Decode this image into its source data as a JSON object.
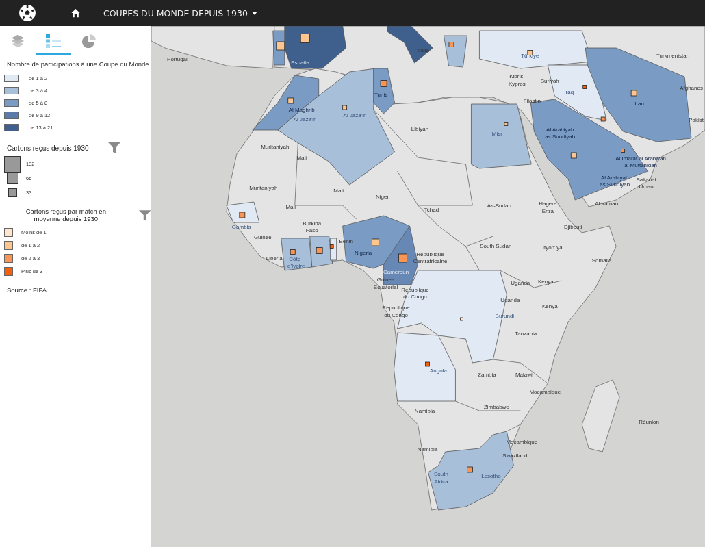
{
  "topbar": {
    "title": "COUPES DU MONDE DEPUIS 1930"
  },
  "tabs": [
    {
      "kind": "layers",
      "selected": false
    },
    {
      "kind": "legend",
      "selected": true
    },
    {
      "kind": "chart",
      "selected": false
    }
  ],
  "legend": {
    "participations": {
      "title": "Nombre de participations à une Coupe du Monde",
      "items": [
        {
          "label": "de 1 à 2",
          "color": "#e0e9f4"
        },
        {
          "label": "de 3 à 4",
          "color": "#a8bfda"
        },
        {
          "label": "de 5 à 8",
          "color": "#7a9cc4"
        },
        {
          "label": "de 9 à 12",
          "color": "#5b7bab"
        },
        {
          "label": "de 13 à 21",
          "color": "#3f5f8c"
        }
      ]
    },
    "cards": {
      "title": "Cartons reçus depuis 1930",
      "items": [
        {
          "label": "132"
        },
        {
          "label": "66"
        },
        {
          "label": "33"
        }
      ]
    },
    "cards_per_match": {
      "title": "Cartons reçus par match en moyenne depuis 1930",
      "items": [
        {
          "label": "Moins de 1",
          "color": "#fee6ce"
        },
        {
          "label": "de 1 à 2",
          "color": "#fdc691"
        },
        {
          "label": "de 2 à 3",
          "color": "#f99656"
        },
        {
          "label": "Plus de 3",
          "color": "#f4600c"
        }
      ]
    },
    "source": "Source : FIFA"
  },
  "map": {
    "regions": [
      {
        "color": "#3f5f8c"
      },
      {
        "color": "#7a9cc4"
      },
      {
        "color": "#3f5f8c"
      },
      {
        "color": "#a8bfda"
      },
      {
        "color": "#e0e9f4"
      },
      {
        "color": "#7a9cc4"
      },
      {
        "color": "#e0e9f4"
      },
      {
        "color": "#7a9cc4"
      },
      {
        "color": "#a8bfda"
      },
      {
        "color": "#7a9cc4"
      },
      {
        "color": "#a8bfda"
      },
      {
        "color": "#7a9cc4"
      },
      {
        "color": "#e0e9f4"
      },
      {
        "color": "#a8bfda"
      },
      {
        "color": "#a8bfda"
      },
      {
        "color": "#e0e9f4"
      },
      {
        "color": "#7a9cc4"
      },
      {
        "color": "#6787b5"
      },
      {
        "color": "#e0e9f4"
      },
      {
        "color": "#e0e9f4"
      },
      {
        "color": "#a8bfda"
      }
    ],
    "markers": [
      {
        "color": "#fdc691"
      },
      {
        "color": "#fdc691"
      },
      {
        "color": "#f99656"
      },
      {
        "color": "#fdc691"
      },
      {
        "color": "#f4600c"
      },
      {
        "color": "#fdc691"
      },
      {
        "color": "#f99656"
      },
      {
        "color": "#fdc691"
      },
      {
        "color": "#fdc691"
      },
      {
        "color": "#fdc691"
      },
      {
        "color": "#fdc691"
      },
      {
        "color": "#f99656"
      },
      {
        "color": "#f99656"
      },
      {
        "color": "#f99656"
      },
      {
        "color": "#f99656"
      },
      {
        "color": "#f99656"
      },
      {
        "color": "#f4600c"
      },
      {
        "color": "#fdc691"
      },
      {
        "color": "#f99656"
      },
      {
        "color": "#fee6ce"
      },
      {
        "color": "#f4600c"
      },
      {
        "color": "#f99656"
      }
    ],
    "labels": [
      "Portugal",
      "España",
      "Italia",
      "Türkiye",
      "Turkmenistan",
      "Kibris,",
      "Kypros",
      "Suriyah",
      "Iraq",
      "Iran",
      "Afghanes",
      "Pakist",
      "Filastin",
      "Al Maghrib",
      "Al Jaza'ir",
      "Al Jaza'ir",
      "Tunis",
      "Libiyah",
      "Misr",
      "Al Arabiyah",
      "as Suudiyah",
      "Al Imarat al Arabiyah",
      "al Muttahidah",
      "Al Arabiyah",
      "as Suudiyah",
      "Saltanat",
      "Uman",
      "Al Yaman",
      "Muritaniyah",
      "Muritaniyah",
      "Mali",
      "Mali",
      "Mali",
      "Niger",
      "Tchad",
      "As-Sudan",
      "Hagere",
      "Ertra",
      "Djibouti",
      "South Sudan",
      "Ityop'iya",
      "Somalia",
      "Gambia",
      "Burkina",
      "Faso",
      "Guinee",
      "Liberia",
      "Côte",
      "d'Ivoire",
      "Benin",
      "Nigeria",
      "Cameroun",
      "Republique",
      "Centrafricaine",
      "Guinea",
      "Ecuatorial",
      "Republique",
      "du Congo",
      "Republique",
      "du Congo",
      "Uganda",
      "Uganda",
      "Kenya",
      "Kenya",
      "Burundi",
      "Tanzania",
      "Angola",
      "Zambia",
      "Malawi",
      "Mocambique",
      "Zimbabwe",
      "Namibia",
      "Namibia",
      "Mocambique",
      "Swaziland",
      "South",
      "Africa",
      "Lesotho",
      "Réunion"
    ]
  }
}
